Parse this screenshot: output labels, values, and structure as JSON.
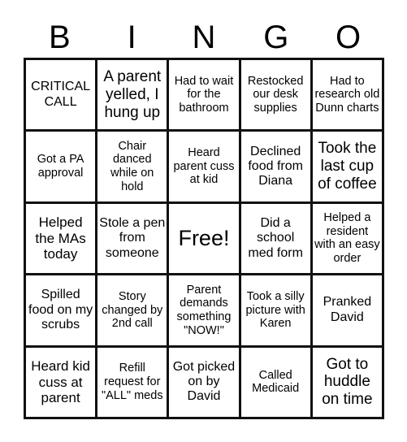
{
  "header": {
    "letters": [
      "B",
      "I",
      "N",
      "G",
      "O"
    ]
  },
  "board": {
    "rows": [
      [
        "CRITICAL CALL",
        "A parent yelled, I hung up",
        "Had to wait for the bathroom",
        "Restocked our desk supplies",
        "Had to research old Dunn charts"
      ],
      [
        "Got a PA approval",
        "Chair danced while on hold",
        "Heard parent cuss at kid",
        "Declined food from Diana",
        "Took the last cup of coffee"
      ],
      [
        "Helped the MAs today",
        "Stole a pen from someone",
        "Free!",
        "Did a school med form",
        "Helped a resident with an easy order"
      ],
      [
        "Spilled food on my scrubs",
        "Story changed by 2nd call",
        "Parent demands something \"NOW!\"",
        "Took a silly picture with Karen",
        "Pranked David"
      ],
      [
        "Heard kid cuss at parent",
        "Refill request for \"ALL\" meds",
        "Got picked on by David",
        "Called Medicaid",
        "Got to huddle on time"
      ]
    ]
  },
  "colors": {
    "border": "#111111",
    "background": "#ffffff",
    "text": "#000000"
  }
}
